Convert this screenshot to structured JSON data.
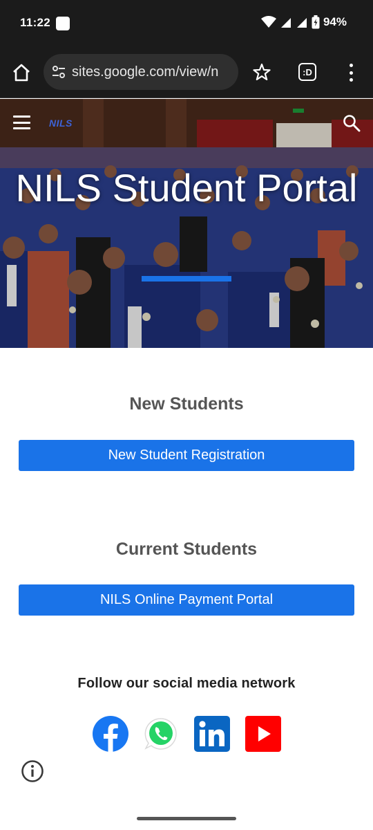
{
  "status_bar": {
    "time": "11:22",
    "battery": "94%"
  },
  "browser": {
    "url": "sites.google.com/view/n",
    "tabs_label": ":D"
  },
  "hero": {
    "logo_text": "NILS",
    "title": "NILS Student Portal",
    "accent_color": "#1a73e8"
  },
  "new_students": {
    "heading": "New Students",
    "button_label": "New Student Registration"
  },
  "current_students": {
    "heading": "Current Students",
    "button_label": "NILS Online Payment Portal"
  },
  "social": {
    "heading": "Follow our social media network",
    "icons": [
      "facebook-icon",
      "whatsapp-icon",
      "linkedin-icon",
      "youtube-icon"
    ]
  }
}
